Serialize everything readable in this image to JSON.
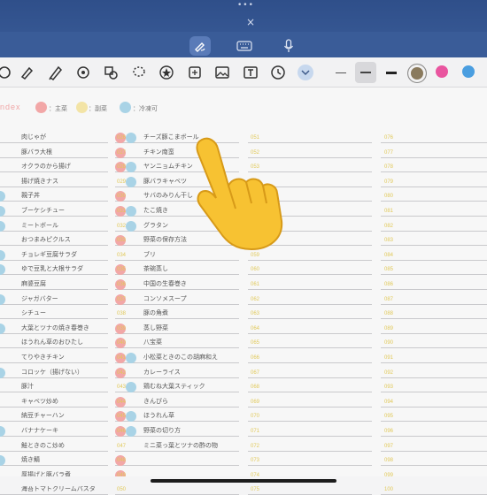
{
  "header": {
    "tab_dots": "•••",
    "close": "×"
  },
  "colors": {
    "topbar": "#3a5c98",
    "pink": "#f2a7a7",
    "yellow": "#f3e4a6",
    "blue": "#a9d3e6",
    "accent_pink": "#e9559f",
    "accent_blue": "#4a9ee0"
  },
  "legend": {
    "title": "ndex",
    "main": "：主菜",
    "side": "：副菜",
    "freezer": "：冷凍可"
  },
  "col1": [
    "肉じゃが",
    "豚バラ大根",
    "オクラのから揚げ",
    "揚げ焼きナス",
    "親子丼",
    "ブーケシチュー",
    "ミートボール",
    "おつまみピクルス",
    "チョレギ豆腐サラダ",
    "ゆで豆乳と大根サラダ",
    "麻婆豆腐",
    "ジャガバター",
    "シチュー",
    "大葉とツナの焼き春巻き",
    "ほうれん草のおひたし",
    "てりやきチキン",
    "コロッケ（揚げない）",
    "豚汁",
    "キャベツ炒め",
    "納豆チャーハン",
    "バナナケーキ",
    "鮭ときのこ炒め",
    "焼き鯖",
    "厚揚げと豚バラ煮",
    "海苔トマトクリームパスタ"
  ],
  "col2": [
    "チーズ豚こまボール",
    "チキン南蛮",
    "ヤンニョムチキン",
    "豚バラキャベツ",
    "サバのみりん干し",
    "たこ焼き",
    "グラタン",
    "野菜の保存方法",
    "ブリ",
    "茶碗蒸し",
    "中国の生春巻き",
    "コンソメスープ",
    "豚の角煮",
    "蒸し野菜",
    "八宝菜",
    "小松菜ときのこの胡麻和え",
    "カレーライス",
    "鶏むね大葉スティック",
    "きんぴら",
    "ほうれん草",
    "野菜の切り方",
    "ミニ菜っ葉とツナの酢の物"
  ],
  "col2_nums": [
    "026",
    "027",
    "028",
    "029",
    "030",
    "031",
    "032",
    "033",
    "034",
    "035",
    "036",
    "037",
    "038",
    "039",
    "040",
    "041",
    "042",
    "043",
    "044",
    "045",
    "046",
    "047",
    "048",
    "049",
    "050"
  ],
  "col3_nums": [
    "051",
    "052",
    "053",
    "054",
    "055",
    "056",
    "057",
    "058",
    "059",
    "060",
    "061",
    "062",
    "063",
    "064",
    "065",
    "066",
    "067",
    "068",
    "069",
    "070",
    "071",
    "072",
    "073",
    "074",
    "075"
  ],
  "col4_nums": [
    "076",
    "077",
    "078",
    "079",
    "080",
    "081",
    "082",
    "083",
    "084",
    "085",
    "086",
    "087",
    "088",
    "089",
    "090",
    "091",
    "092",
    "093",
    "094",
    "095",
    "096",
    "097",
    "098",
    "099",
    "100"
  ]
}
